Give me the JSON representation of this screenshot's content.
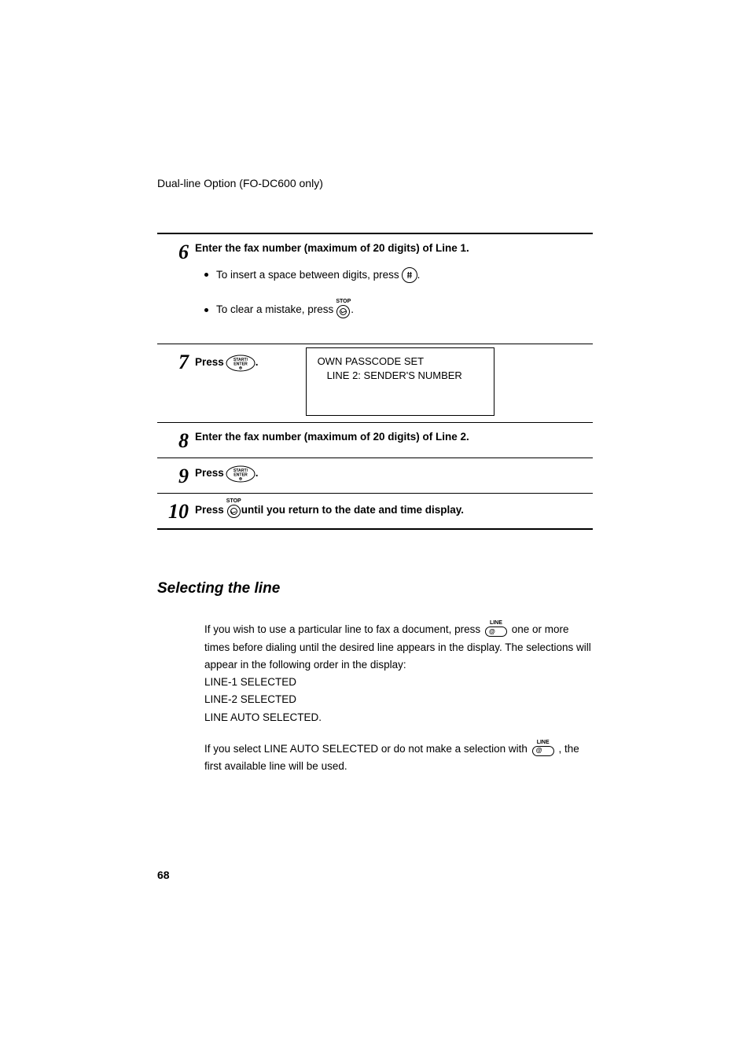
{
  "header": "Dual-line Option (FO-DC600 only)",
  "steps": {
    "s6": {
      "num": "6",
      "lead": "Enter the fax number (maximum of 20 digits) of Line 1.",
      "b1_pre": "To insert  a space between digits, press ",
      "b1_post": " .",
      "b2_pre": "To clear a mistake, press  ",
      "b2_post": " ."
    },
    "s7": {
      "num": "7",
      "press": "Press ",
      "dot": ".",
      "disp1": "OWN PASSCODE SET",
      "disp2": "LINE 2: SENDER'S NUMBER"
    },
    "s8": {
      "num": "8",
      "lead": "Enter the fax number (maximum of 20 digits) of Line 2."
    },
    "s9": {
      "num": "9",
      "press": "Press ",
      "dot": "."
    },
    "s10": {
      "num": "10",
      "press": "Press ",
      "tail": " until you return to the date and time display."
    }
  },
  "section_title": "Selecting the line",
  "para1": {
    "a": "If you wish to use a particular line to fax a document, press ",
    "b": " one or more times before dialing until the desired line appears in the display. The selections will appear in the following order in the display:",
    "l1": "LINE-1 SELECTED",
    "l2": "LINE-2 SELECTED",
    "l3": "LINE AUTO SELECTED."
  },
  "para2": {
    "a": "If you select LINE AUTO SELECTED or do not make a selection with ",
    "b": ", the first available line will be used."
  },
  "icons": {
    "stop_label": "STOP",
    "line_label": "LINE",
    "at": "@"
  },
  "page_num": "68"
}
